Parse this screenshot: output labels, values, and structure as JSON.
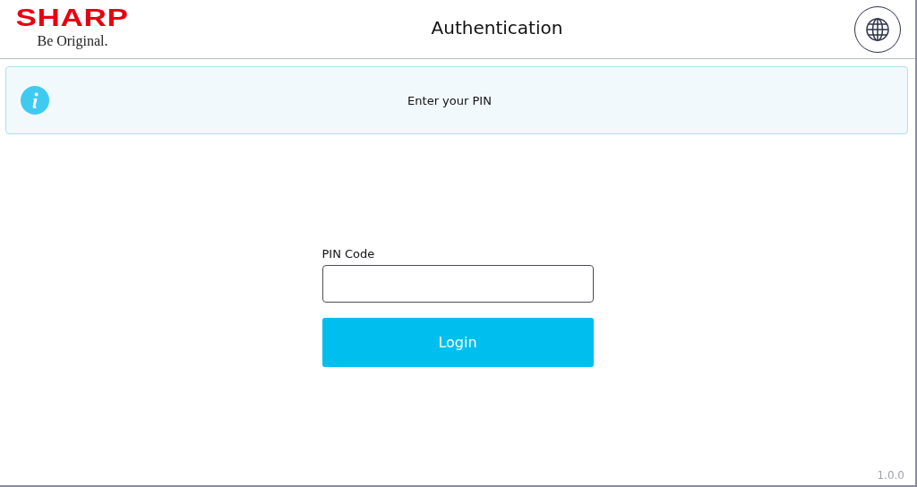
{
  "header": {
    "brand": "SHARP",
    "tagline": "Be Original.",
    "title": "Authentication"
  },
  "message": {
    "text": "Enter your PIN"
  },
  "form": {
    "label": "PIN Code",
    "button": "Login"
  },
  "version": "1.0.0"
}
